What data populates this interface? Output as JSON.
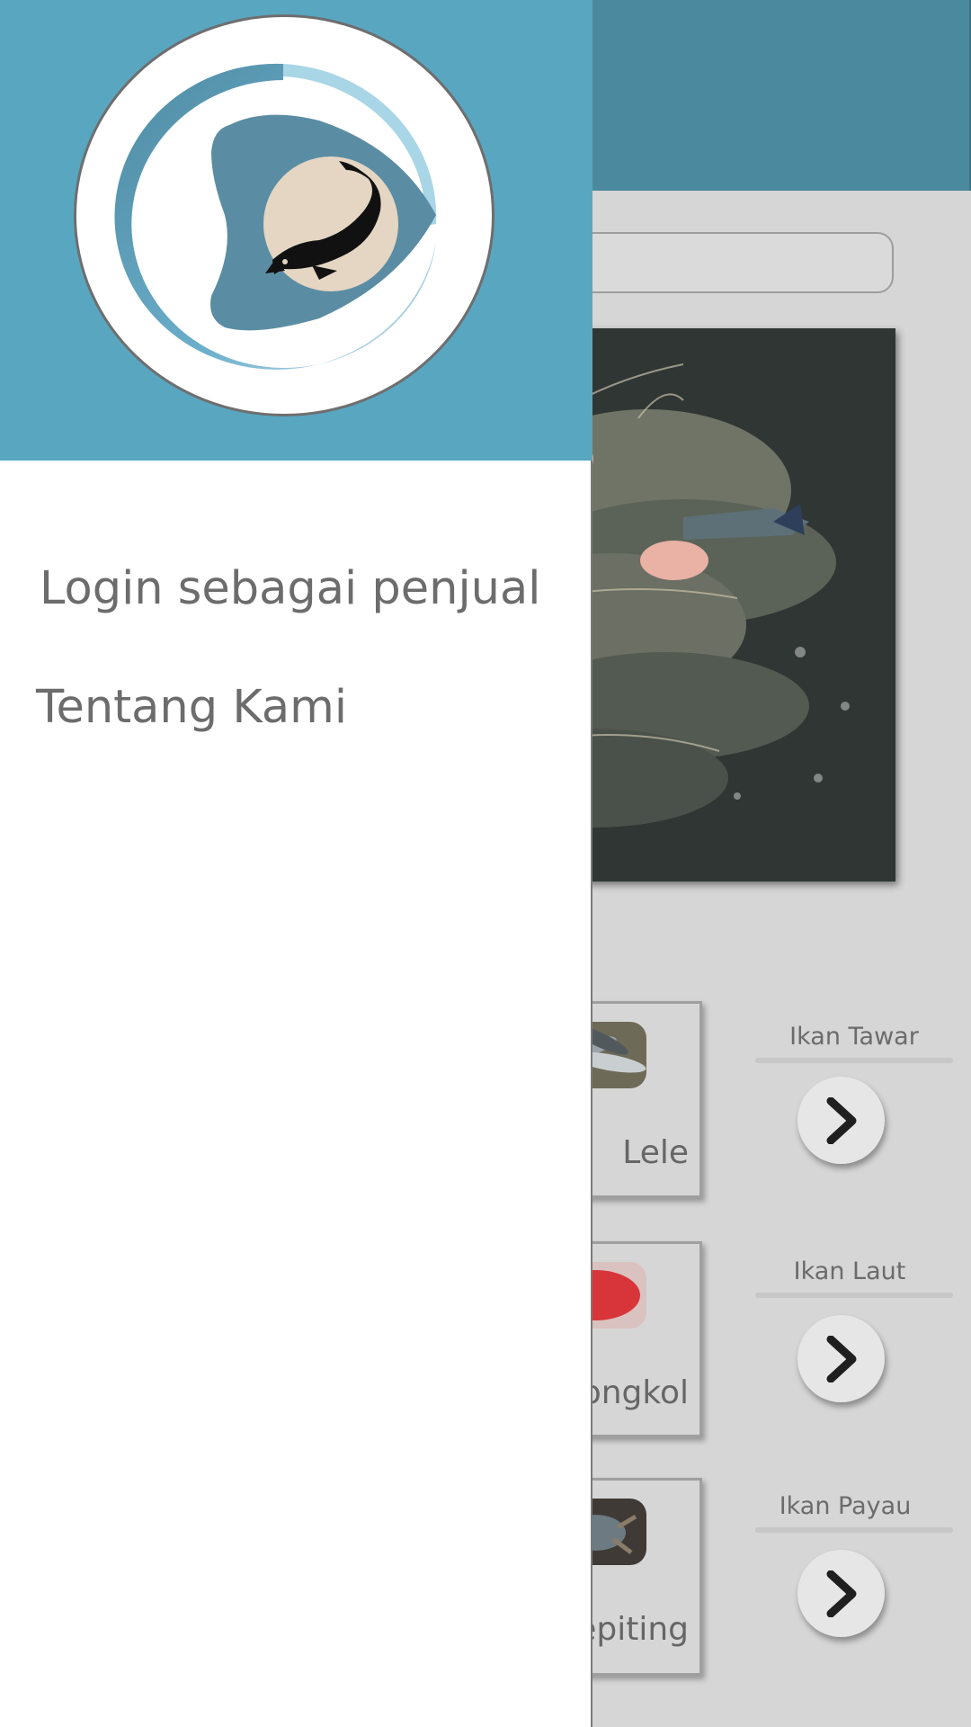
{
  "drawer": {
    "menu": [
      {
        "label": "Login sebagai penjual"
      },
      {
        "label": "Tentang Kami"
      }
    ]
  },
  "products": [
    {
      "name": "Lele"
    },
    {
      "name": "ongkol"
    },
    {
      "name": "epiting"
    }
  ],
  "categories": [
    {
      "title": "Ikan Tawar"
    },
    {
      "title": "Ikan Laut"
    },
    {
      "title": "Ikan Payau"
    }
  ],
  "icons": {
    "logo": "fish-logo-icon",
    "arrow": "chevron-right-icon"
  },
  "colors": {
    "header": "#4b8a9e",
    "drawer_header": "#59a6c1",
    "logo_fin": "#5a8da3",
    "logo_badge": "#e4d6c3"
  }
}
